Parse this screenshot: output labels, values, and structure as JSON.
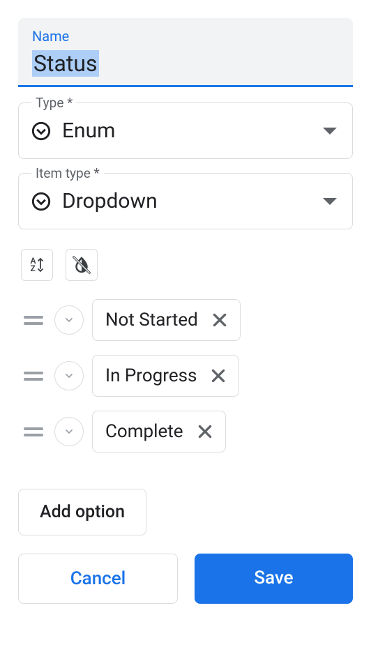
{
  "name_field": {
    "label": "Name",
    "value": "Status"
  },
  "type_field": {
    "label": "Type *",
    "value": "Enum"
  },
  "item_type_field": {
    "label": "Item type *",
    "value": "Dropdown"
  },
  "options": [
    {
      "label": "Not Started"
    },
    {
      "label": "In Progress"
    },
    {
      "label": "Complete"
    }
  ],
  "buttons": {
    "add_option": "Add option",
    "cancel": "Cancel",
    "save": "Save"
  }
}
